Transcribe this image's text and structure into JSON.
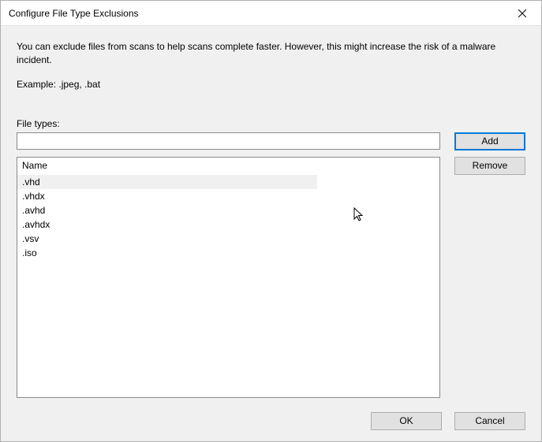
{
  "titlebar": {
    "title": "Configure File Type Exclusions"
  },
  "description": "You can exclude files from scans to help scans complete faster. However, this might increase the risk of a malware incident.",
  "example_label": "Example: .jpeg, .bat",
  "file_types_label": "File types:",
  "file_types_value": "",
  "buttons": {
    "add": "Add",
    "remove": "Remove",
    "ok": "OK",
    "cancel": "Cancel"
  },
  "list": {
    "header": "Name",
    "items": [
      {
        "text": ".vhd",
        "selected": true
      },
      {
        "text": ".vhdx",
        "selected": false
      },
      {
        "text": ".avhd",
        "selected": false
      },
      {
        "text": ".avhdx",
        "selected": false
      },
      {
        "text": ".vsv",
        "selected": false
      },
      {
        "text": ".iso",
        "selected": false
      }
    ]
  }
}
